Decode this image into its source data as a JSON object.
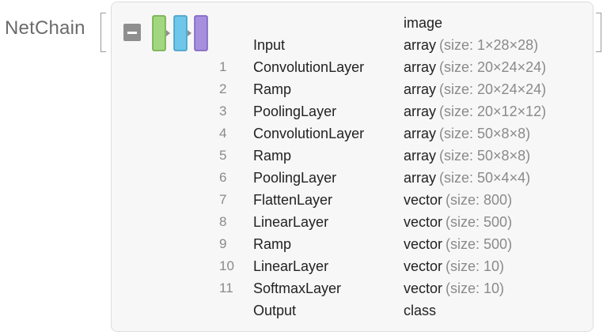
{
  "head": "NetChain",
  "colors": {
    "block1": "#a3d77f",
    "block2": "#6ec7e8",
    "block3": "#a68fdd",
    "toggle": "#8f8f8f",
    "index": "#8a8a8a",
    "secondary": "#8a8a8a"
  },
  "input_header": {
    "type": "image"
  },
  "input": {
    "name": "Input",
    "kind": "array",
    "size": "(size: 1×28×28)"
  },
  "layers": [
    {
      "idx": "1",
      "name": "ConvolutionLayer",
      "kind": "array",
      "size": "(size: 20×24×24)"
    },
    {
      "idx": "2",
      "name": "Ramp",
      "kind": "array",
      "size": "(size: 20×24×24)"
    },
    {
      "idx": "3",
      "name": "PoolingLayer",
      "kind": "array",
      "size": "(size: 20×12×12)"
    },
    {
      "idx": "4",
      "name": "ConvolutionLayer",
      "kind": "array",
      "size": "(size: 50×8×8)"
    },
    {
      "idx": "5",
      "name": "Ramp",
      "kind": "array",
      "size": "(size: 50×8×8)"
    },
    {
      "idx": "6",
      "name": "PoolingLayer",
      "kind": "array",
      "size": "(size: 50×4×4)"
    },
    {
      "idx": "7",
      "name": "FlattenLayer",
      "kind": "vector",
      "size": "(size: 800)"
    },
    {
      "idx": "8",
      "name": "LinearLayer",
      "kind": "vector",
      "size": "(size: 500)"
    },
    {
      "idx": "9",
      "name": "Ramp",
      "kind": "vector",
      "size": "(size: 500)"
    },
    {
      "idx": "10",
      "name": "LinearLayer",
      "kind": "vector",
      "size": "(size: 10)"
    },
    {
      "idx": "11",
      "name": "SoftmaxLayer",
      "kind": "vector",
      "size": "(size: 10)"
    }
  ],
  "output": {
    "name": "Output",
    "kind": "class"
  }
}
